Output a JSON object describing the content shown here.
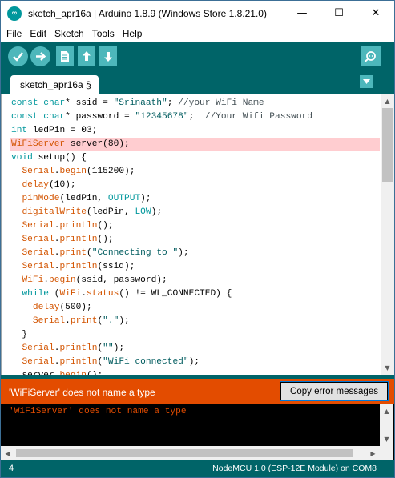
{
  "window": {
    "title": "sketch_apr16a | Arduino 1.8.9 (Windows Store 1.8.21.0)",
    "controls": {
      "minimize": "—",
      "maximize": "☐",
      "close": "✕"
    }
  },
  "menu": [
    "File",
    "Edit",
    "Sketch",
    "Tools",
    "Help"
  ],
  "toolbar": {
    "buttons": [
      "verify",
      "upload",
      "new",
      "open",
      "save",
      "serial-monitor"
    ]
  },
  "tabs": [
    {
      "label": "sketch_apr16a §"
    }
  ],
  "tab_menu_icon": "triangle-down-icon",
  "code": [
    [
      {
        "t": "const ",
        "c": "kw"
      },
      {
        "t": "char",
        "c": "kw"
      },
      {
        "t": "* ssid = ",
        "c": ""
      },
      {
        "t": "\"Srinaath\"",
        "c": "str"
      },
      {
        "t": "; ",
        "c": ""
      },
      {
        "t": "//your WiFi Name",
        "c": "cm"
      }
    ],
    [
      {
        "t": "const ",
        "c": "kw"
      },
      {
        "t": "char",
        "c": "kw"
      },
      {
        "t": "* password = ",
        "c": ""
      },
      {
        "t": "\"12345678\"",
        "c": "str"
      },
      {
        "t": ";  ",
        "c": ""
      },
      {
        "t": "//Your Wifi Password",
        "c": "cm"
      }
    ],
    [
      {
        "t": "int",
        "c": "kw"
      },
      {
        "t": " ledPin = 03;",
        "c": ""
      }
    ],
    [
      {
        "t": "WiFiServer",
        "c": "fn"
      },
      {
        "t": " server(80);",
        "c": ""
      }
    ],
    [
      {
        "t": "void",
        "c": "kw"
      },
      {
        "t": " setup() {",
        "c": ""
      }
    ],
    [
      {
        "t": "  ",
        "c": ""
      },
      {
        "t": "Serial",
        "c": "fn"
      },
      {
        "t": ".",
        "c": ""
      },
      {
        "t": "begin",
        "c": "fn"
      },
      {
        "t": "(115200);",
        "c": ""
      }
    ],
    [
      {
        "t": "  ",
        "c": ""
      },
      {
        "t": "delay",
        "c": "fn"
      },
      {
        "t": "(10);",
        "c": ""
      }
    ],
    [
      {
        "t": "  ",
        "c": ""
      },
      {
        "t": "pinMode",
        "c": "fn"
      },
      {
        "t": "(ledPin, ",
        "c": ""
      },
      {
        "t": "OUTPUT",
        "c": "const"
      },
      {
        "t": ");",
        "c": ""
      }
    ],
    [
      {
        "t": "  ",
        "c": ""
      },
      {
        "t": "digitalWrite",
        "c": "fn"
      },
      {
        "t": "(ledPin, ",
        "c": ""
      },
      {
        "t": "LOW",
        "c": "const"
      },
      {
        "t": ");",
        "c": ""
      }
    ],
    [
      {
        "t": "  ",
        "c": ""
      },
      {
        "t": "Serial",
        "c": "fn"
      },
      {
        "t": ".",
        "c": ""
      },
      {
        "t": "println",
        "c": "fn"
      },
      {
        "t": "();",
        "c": ""
      }
    ],
    [
      {
        "t": "  ",
        "c": ""
      },
      {
        "t": "Serial",
        "c": "fn"
      },
      {
        "t": ".",
        "c": ""
      },
      {
        "t": "println",
        "c": "fn"
      },
      {
        "t": "();",
        "c": ""
      }
    ],
    [
      {
        "t": "  ",
        "c": ""
      },
      {
        "t": "Serial",
        "c": "fn"
      },
      {
        "t": ".",
        "c": ""
      },
      {
        "t": "print",
        "c": "fn"
      },
      {
        "t": "(",
        "c": ""
      },
      {
        "t": "\"Connecting to \"",
        "c": "str"
      },
      {
        "t": ");",
        "c": ""
      }
    ],
    [
      {
        "t": "  ",
        "c": ""
      },
      {
        "t": "Serial",
        "c": "fn"
      },
      {
        "t": ".",
        "c": ""
      },
      {
        "t": "println",
        "c": "fn"
      },
      {
        "t": "(ssid);",
        "c": ""
      }
    ],
    [
      {
        "t": "  ",
        "c": ""
      },
      {
        "t": "WiFi",
        "c": "fn"
      },
      {
        "t": ".",
        "c": ""
      },
      {
        "t": "begin",
        "c": "fn"
      },
      {
        "t": "(ssid, password);",
        "c": ""
      }
    ],
    [
      {
        "t": "  ",
        "c": ""
      },
      {
        "t": "while",
        "c": "kw"
      },
      {
        "t": " (",
        "c": ""
      },
      {
        "t": "WiFi",
        "c": "fn"
      },
      {
        "t": ".",
        "c": ""
      },
      {
        "t": "status",
        "c": "fn"
      },
      {
        "t": "() != WL_CONNECTED) {",
        "c": ""
      }
    ],
    [
      {
        "t": "    ",
        "c": ""
      },
      {
        "t": "delay",
        "c": "fn"
      },
      {
        "t": "(500);",
        "c": ""
      }
    ],
    [
      {
        "t": "    ",
        "c": ""
      },
      {
        "t": "Serial",
        "c": "fn"
      },
      {
        "t": ".",
        "c": ""
      },
      {
        "t": "print",
        "c": "fn"
      },
      {
        "t": "(",
        "c": ""
      },
      {
        "t": "\".\"",
        "c": "str"
      },
      {
        "t": ");",
        "c": ""
      }
    ],
    [
      {
        "t": "  }",
        "c": ""
      }
    ],
    [
      {
        "t": "  ",
        "c": ""
      },
      {
        "t": "Serial",
        "c": "fn"
      },
      {
        "t": ".",
        "c": ""
      },
      {
        "t": "println",
        "c": "fn"
      },
      {
        "t": "(",
        "c": ""
      },
      {
        "t": "\"\"",
        "c": "str"
      },
      {
        "t": ");",
        "c": ""
      }
    ],
    [
      {
        "t": "  ",
        "c": ""
      },
      {
        "t": "Serial",
        "c": "fn"
      },
      {
        "t": ".",
        "c": ""
      },
      {
        "t": "println",
        "c": "fn"
      },
      {
        "t": "(",
        "c": ""
      },
      {
        "t": "\"WiFi connected\"",
        "c": "str"
      },
      {
        "t": ");",
        "c": ""
      }
    ],
    [
      {
        "t": "  ",
        "c": ""
      },
      {
        "t": "server",
        "c": ""
      },
      {
        "t": ".",
        "c": ""
      },
      {
        "t": "begin",
        "c": "fn"
      },
      {
        "t": "();",
        "c": ""
      }
    ]
  ],
  "error_line_index": 3,
  "error_bar": {
    "message": "'WiFiServer' does not name a type",
    "copy_button": "Copy error messages"
  },
  "console": {
    "text": "'WiFiServer' does not name a type"
  },
  "status": {
    "line_number": "4",
    "board": "NodeMCU 1.0 (ESP-12E Module) on COM8"
  },
  "colors": {
    "toolbar": "#006468",
    "button": "#4db7bb",
    "error_bar": "#e34c00",
    "error_highlight": "#ffcdd0",
    "keyword": "#00979c",
    "function": "#d35400",
    "string": "#005c5f"
  }
}
